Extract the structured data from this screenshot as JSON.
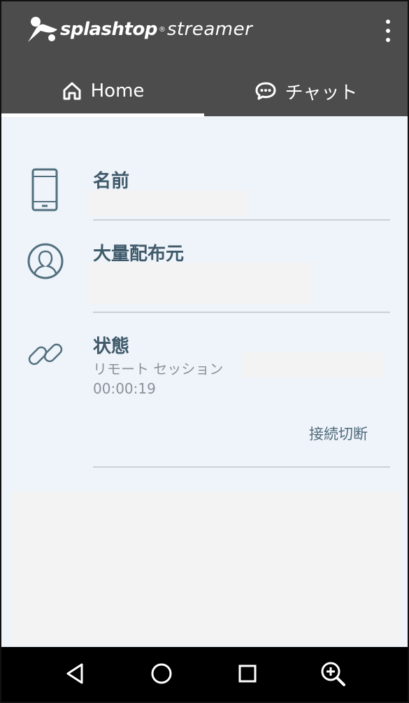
{
  "header": {
    "logo": {
      "brand": "splashtop",
      "registered": "®",
      "product": "streamer"
    },
    "menu_icon": "more-vert-icon"
  },
  "tabs": [
    {
      "label": "Home",
      "icon": "home-icon",
      "active": true
    },
    {
      "label": "チャット",
      "icon": "chat-icon",
      "active": false
    }
  ],
  "rows": {
    "name": {
      "title": "名前",
      "icon": "phone-icon"
    },
    "distributor": {
      "title": "大量配布元",
      "icon": "user-icon"
    },
    "status": {
      "title": "状態",
      "icon": "link-icon",
      "session_label": "リモート セッション",
      "elapsed": "00:00:19",
      "disconnect_label": "接続切断"
    }
  },
  "navbar": {
    "icons": [
      "back-icon",
      "home-circle-icon",
      "recents-icon",
      "zoom-in-icon"
    ]
  },
  "colors": {
    "header_bg": "#4c4c4c",
    "content_bg": "#eff3fa",
    "title_text": "#3f5a6a",
    "muted_text": "#8a9298",
    "navbar_bg": "#000000"
  }
}
